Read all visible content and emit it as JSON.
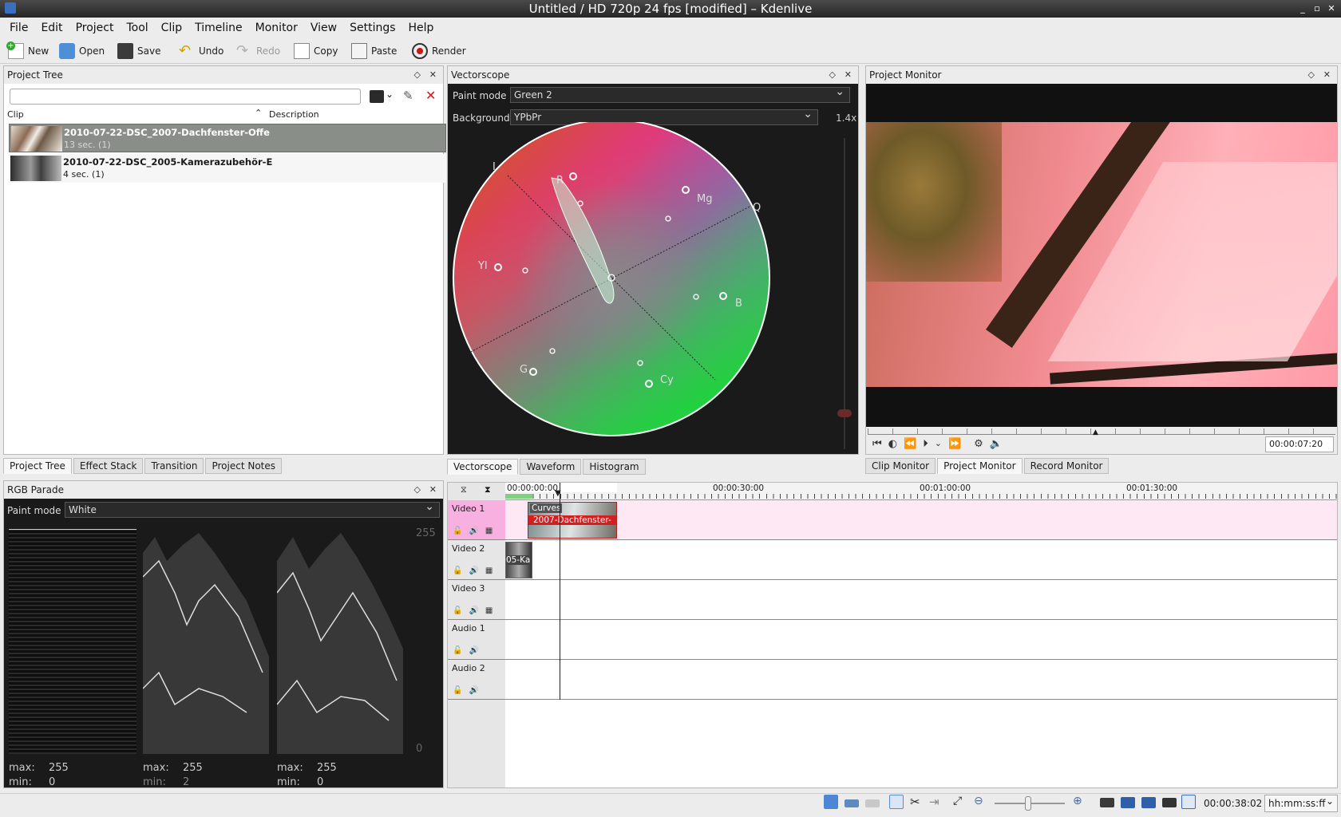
{
  "window": {
    "title": "Untitled / HD 720p 24 fps [modified] – Kdenlive"
  },
  "menu": [
    "File",
    "Edit",
    "Project",
    "Tool",
    "Clip",
    "Timeline",
    "Monitor",
    "View",
    "Settings",
    "Help"
  ],
  "toolbar": {
    "new": "New",
    "open": "Open",
    "save": "Save",
    "undo": "Undo",
    "redo": "Redo",
    "copy": "Copy",
    "paste": "Paste",
    "render": "Render"
  },
  "project_tree": {
    "title": "Project Tree",
    "col_clip": "Clip",
    "col_desc": "Description",
    "clips": [
      {
        "name": "2010-07-22-DSC_2007-Dachfenster-Offe",
        "info": "13 sec. (1)"
      },
      {
        "name": "2010-07-22-DSC_2005-Kamerazubehör-E",
        "info": "4 sec. (1)"
      }
    ]
  },
  "left_tabs": [
    "Project Tree",
    "Effect Stack",
    "Transition",
    "Project Notes"
  ],
  "vectorscope": {
    "title": "Vectorscope",
    "paint_mode_label": "Paint mode",
    "paint_mode": "Green 2",
    "background_label": "Background",
    "background": "YPbPr",
    "zoom": "1.4x",
    "labels": {
      "i": "I",
      "q": "Q",
      "r": "R",
      "mg": "Mg",
      "yl": "Yl",
      "b": "B",
      "g": "G",
      "cy": "Cy"
    }
  },
  "mid_tabs": [
    "Vectorscope",
    "Waveform",
    "Histogram"
  ],
  "project_monitor": {
    "title": "Project Monitor",
    "timecode": "00:00:07:20"
  },
  "right_tabs": [
    "Clip Monitor",
    "Project Monitor",
    "Record Monitor"
  ],
  "rgb_parade": {
    "title": "RGB Parade",
    "paint_mode_label": "Paint mode",
    "paint_mode": "White",
    "scale_top": "255",
    "scale_bottom": "0",
    "stats": [
      {
        "max_label": "max:",
        "max": "255",
        "min_label": "min:",
        "min": "0"
      },
      {
        "max_label": "max:",
        "max": "255",
        "min_label": "min:",
        "min": "2"
      },
      {
        "max_label": "max:",
        "max": "255",
        "min_label": "min:",
        "min": "0"
      }
    ]
  },
  "timeline": {
    "ruler": [
      "00:00:00:00",
      "00:00:30:00",
      "00:01:00:00",
      "00:01:30:00"
    ],
    "tracks": [
      "Video 1",
      "Video 2",
      "Video 3",
      "Audio 1",
      "Audio 2"
    ],
    "clip1_effect": "Curves",
    "clip1_label": "2007-Dachfenster-",
    "clip2_label": "05-Ka"
  },
  "status": {
    "timecode": "00:00:38:02",
    "format": "hh:mm:ss:ff"
  }
}
